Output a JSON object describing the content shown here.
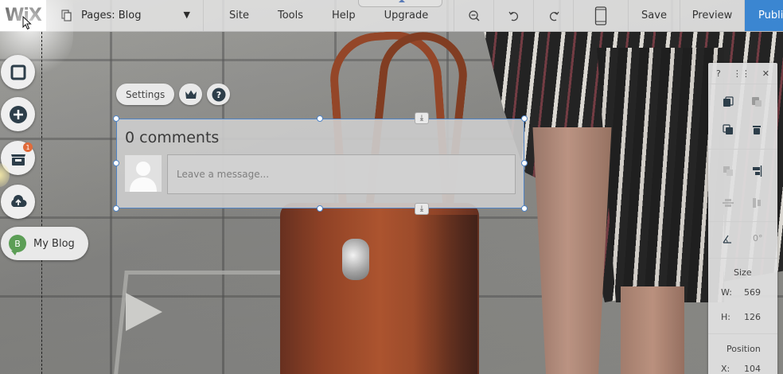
{
  "topbar": {
    "logo": "WiX",
    "pages_label": "Pages: Blog",
    "nav": [
      "Site",
      "Tools",
      "Help",
      "Upgrade"
    ],
    "save": "Save",
    "preview": "Preview",
    "publish": "Publish"
  },
  "rail": {
    "badge_count": "1",
    "blog_letter": "B",
    "blog_label": "My Blog"
  },
  "widget": {
    "settings_label": "Settings",
    "title": "0 comments",
    "message_placeholder": "Leave a message..."
  },
  "panel": {
    "help": "?",
    "rotation": "0°",
    "size_label": "Size",
    "w_label": "W:",
    "w_value": "569",
    "h_label": "H:",
    "h_value": "126",
    "position_label": "Position",
    "x_label": "X:",
    "x_value": "104"
  },
  "colors": {
    "publish_bg": "#3b86d1",
    "selection": "#4f83c4",
    "blog_badge": "#5c9e56",
    "notification": "#e06b3a"
  }
}
